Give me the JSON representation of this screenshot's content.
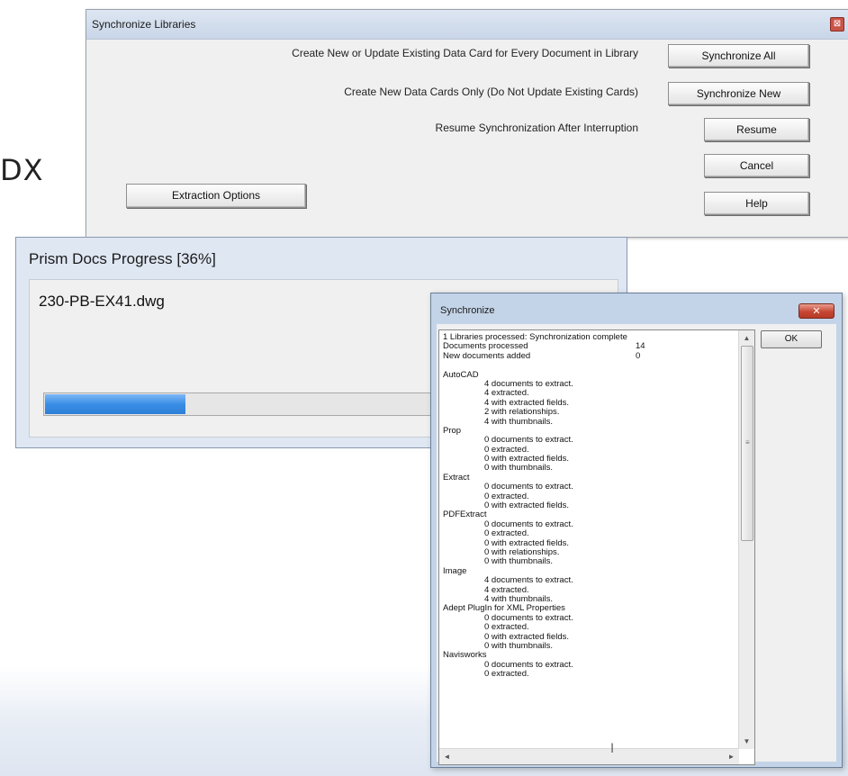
{
  "background": {
    "fragment_text": "DX"
  },
  "sync_libraries": {
    "title": "Synchronize Libraries",
    "close_glyph": "⊠",
    "rows": [
      {
        "description": "Create New or Update Existing Data Card for Every Document in Library",
        "button": "Synchronize All"
      },
      {
        "description": "Create New Data Cards Only (Do Not Update Existing Cards)",
        "button": "Synchronize New"
      },
      {
        "description": "Resume Synchronization After Interruption",
        "button": "Resume"
      }
    ],
    "cancel_button": "Cancel",
    "help_button": "Help",
    "extraction_button": "Extraction Options"
  },
  "progress": {
    "title": "Prism Docs Progress [36%]",
    "filename": "230-PB-EX41.dwg",
    "percent": 36,
    "bar_color": "#3a8ee6"
  },
  "synchronize": {
    "title": "Synchronize",
    "close_glyph": "✕",
    "ok_button": "OK",
    "log": [
      {
        "text": "1 Libraries processed: Synchronization complete",
        "indent": false
      },
      {
        "text": "Documents processed",
        "value": "14",
        "indent": false
      },
      {
        "text": "New documents added",
        "value": "0",
        "indent": false
      },
      {
        "text": "",
        "indent": false
      },
      {
        "text": "AutoCAD",
        "indent": false
      },
      {
        "text": "4 documents to extract.",
        "indent": true
      },
      {
        "text": "4 extracted.",
        "indent": true
      },
      {
        "text": "4 with extracted fields.",
        "indent": true
      },
      {
        "text": "2 with relationships.",
        "indent": true
      },
      {
        "text": "4 with thumbnails.",
        "indent": true
      },
      {
        "text": "Prop",
        "indent": false
      },
      {
        "text": "0 documents to extract.",
        "indent": true
      },
      {
        "text": "0 extracted.",
        "indent": true
      },
      {
        "text": "0 with extracted fields.",
        "indent": true
      },
      {
        "text": "0 with thumbnails.",
        "indent": true
      },
      {
        "text": "Extract",
        "indent": false
      },
      {
        "text": "0 documents to extract.",
        "indent": true
      },
      {
        "text": "0 extracted.",
        "indent": true
      },
      {
        "text": "0 with extracted fields.",
        "indent": true
      },
      {
        "text": "PDFExtract",
        "indent": false
      },
      {
        "text": "0 documents to extract.",
        "indent": true
      },
      {
        "text": "0 extracted.",
        "indent": true
      },
      {
        "text": "0 with extracted fields.",
        "indent": true
      },
      {
        "text": "0 with relationships.",
        "indent": true
      },
      {
        "text": "0 with thumbnails.",
        "indent": true
      },
      {
        "text": "Image",
        "indent": false
      },
      {
        "text": "4 documents to extract.",
        "indent": true
      },
      {
        "text": "4 extracted.",
        "indent": true
      },
      {
        "text": "4 with thumbnails.",
        "indent": true
      },
      {
        "text": "Adept PlugIn for XML Properties",
        "indent": false
      },
      {
        "text": "0 documents to extract.",
        "indent": true
      },
      {
        "text": "0 extracted.",
        "indent": true
      },
      {
        "text": "0 with extracted fields.",
        "indent": true
      },
      {
        "text": "0 with thumbnails.",
        "indent": true
      },
      {
        "text": "Navisworks",
        "indent": false
      },
      {
        "text": "0 documents to extract.",
        "indent": true
      },
      {
        "text": "0 extracted.",
        "indent": true
      }
    ],
    "icons": {
      "scroll_up": "▲",
      "scroll_down": "▼",
      "scroll_left": "◄",
      "scroll_right": "►",
      "grip": "≡",
      "ibeam": "I"
    }
  }
}
